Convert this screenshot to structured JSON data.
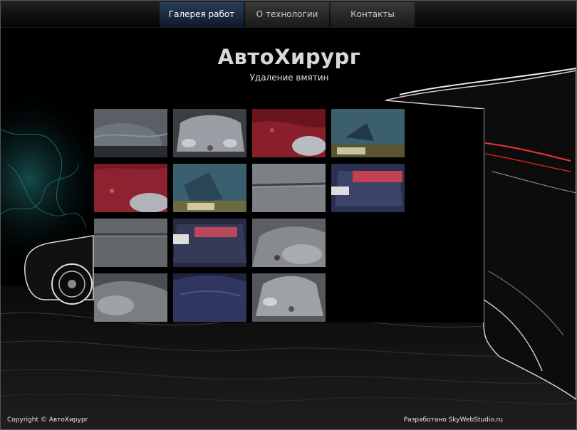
{
  "nav": {
    "items": [
      {
        "label": "Галерея работ",
        "active": true
      },
      {
        "label": "О технологии",
        "active": false
      },
      {
        "label": "Контакты",
        "active": false
      }
    ]
  },
  "header": {
    "title": "АвтоХирург",
    "subtitle": "Удаление вмятин"
  },
  "gallery": {
    "photos": [
      {
        "subject": "grey-car-wing"
      },
      {
        "subject": "silver-car-front"
      },
      {
        "subject": "red-car-headlight"
      },
      {
        "subject": "blue-trunk-plate"
      },
      {
        "subject": "red-car-wing"
      },
      {
        "subject": "blue-trunk-closeup"
      },
      {
        "subject": "grey-door-panel"
      },
      {
        "subject": "dark-car-rear"
      },
      {
        "subject": "grey-door-panel-2"
      },
      {
        "subject": "dark-car-rear-2"
      },
      {
        "subject": "silver-car-headlight"
      },
      {
        "subject": "silver-car-front-2"
      },
      {
        "subject": "blue-car-roof"
      },
      {
        "subject": "silver-car-hood"
      }
    ]
  },
  "footer": {
    "copyright": "Copyright © АвтоХирург",
    "developer": "Разработано SkyWebStudio.ru"
  },
  "colors": {
    "nav_active": "#1a2940",
    "background": "#000000",
    "text": "#d8d8d8"
  }
}
